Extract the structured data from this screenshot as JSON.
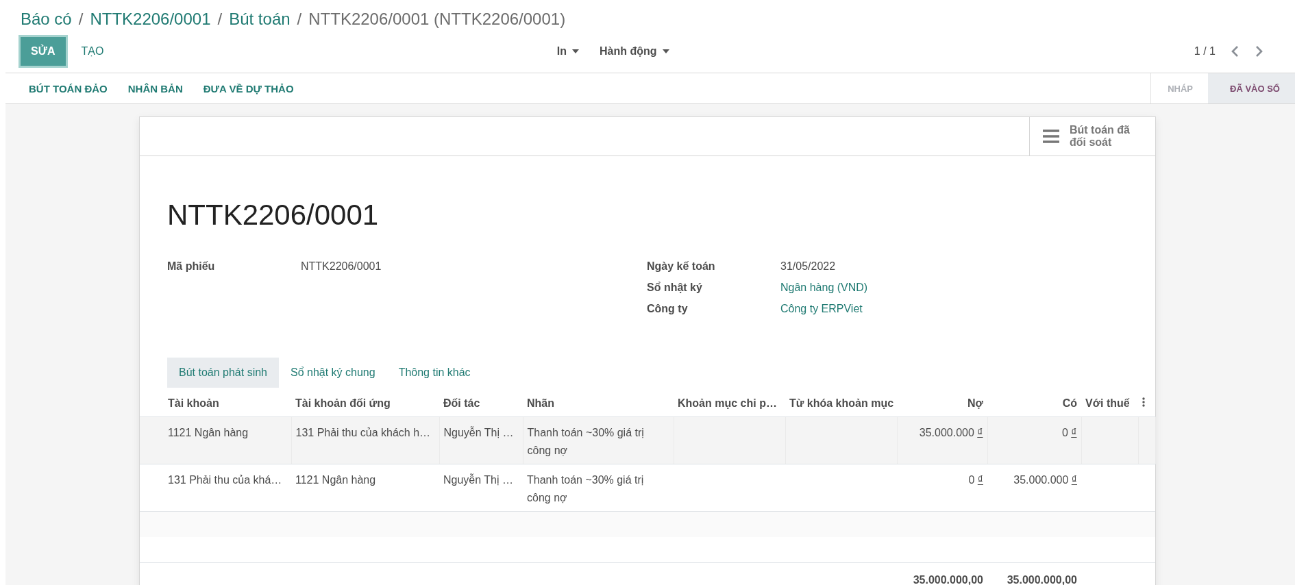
{
  "breadcrumbs": [
    {
      "label": "Báo có",
      "kind": "link"
    },
    {
      "label": "/",
      "kind": "separator"
    },
    {
      "label": "NTTK2206/0001",
      "kind": "link"
    },
    {
      "label": "/",
      "kind": "separator"
    },
    {
      "label": "Bút toán",
      "kind": "link"
    },
    {
      "label": "/",
      "kind": "separator"
    },
    {
      "label": "NTTK2206/0001 (NTTK2206/0001)",
      "kind": "current"
    }
  ],
  "buttons": [
    {
      "label": "SỬA",
      "kind": "primary"
    },
    {
      "label": "TẠO",
      "kind": "secondary"
    }
  ],
  "dropdowns": [
    "In",
    "Hành động"
  ],
  "pager": {
    "text": "1 / 1"
  },
  "actions": [
    "BÚT TOÁN ĐẢO",
    "NHÂN BẢN",
    "ĐƯA VỀ DỰ THẢO"
  ],
  "status_steps": [
    {
      "label": "NHÁP",
      "selected": false
    },
    {
      "label": "ĐÃ VÀO SỔ",
      "selected": true
    }
  ],
  "smart_button": {
    "label": "Bút toán đã đối soát"
  },
  "title": "NTTK2206/0001",
  "fields_left": [
    {
      "label": "Mã phiếu",
      "value": "NTTK2206/0001",
      "kind": "text"
    }
  ],
  "fields_right": [
    {
      "label": "Ngày kế toán",
      "value": "31/05/2022",
      "kind": "text"
    },
    {
      "label": "Sổ nhật ký",
      "value": "Ngân hàng (VND)",
      "kind": "link"
    },
    {
      "label": "Công ty",
      "value": "Công ty ERPViet",
      "kind": "link"
    }
  ],
  "tabs": [
    {
      "label": "Bút toán phát sinh",
      "selected": true
    },
    {
      "label": "Sổ nhật ký chung",
      "selected": false
    },
    {
      "label": "Thông tin khác",
      "selected": false
    }
  ],
  "table": {
    "columns": [
      "Tài khoản",
      "Tài khoản đối ứng",
      "Đối tác",
      "Nhãn",
      "Khoản mục chi p…",
      "Từ khóa khoản mục",
      "Nợ",
      "Có",
      "Với thuế"
    ],
    "rows": [
      {
        "cells": [
          "1121 Ngân hàng",
          "131 Phải thu của khách h…",
          "Nguyễn Thị …",
          "Thanh toán ~30% giá trị công nợ",
          "",
          "",
          "35.000.000",
          "0",
          ""
        ],
        "currency": "₫",
        "hovered": true
      },
      {
        "cells": [
          "131 Phải thu của khá…",
          "1121 Ngân hàng",
          "Nguyễn Thị …",
          "Thanh toán ~30% giá trị công nợ",
          "",
          "",
          "0",
          "35.000.000",
          ""
        ],
        "currency": "₫",
        "hovered": false
      }
    ],
    "totals": {
      "debit": "35.000.000,00",
      "credit": "35.000.000,00"
    }
  }
}
